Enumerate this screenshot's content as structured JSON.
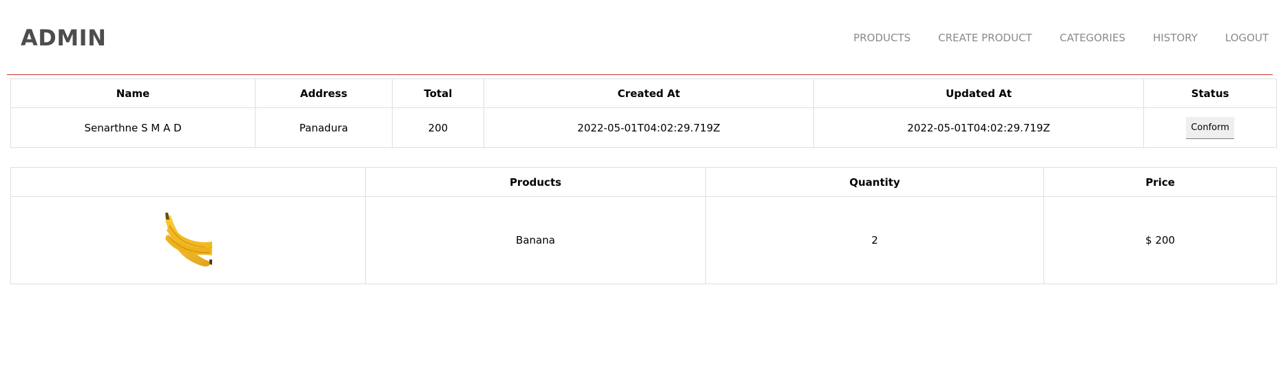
{
  "header": {
    "brand": "ADMIN",
    "nav": [
      "PRODUCTS",
      "CREATE PRODUCT",
      "CATEGORIES",
      "HISTORY",
      "LOGOUT"
    ]
  },
  "order": {
    "columns": [
      "Name",
      "Address",
      "Total",
      "Created At",
      "Updated At",
      "Status"
    ],
    "row": {
      "name": "Senarthne S M A D",
      "address": "Panadura",
      "total": "200",
      "created_at": "2022-05-01T04:02:29.719Z",
      "updated_at": "2022-05-01T04:02:29.719Z",
      "status_button": "Conform"
    }
  },
  "items": {
    "columns": [
      "",
      "Products",
      "Quantity",
      "Price"
    ],
    "rows": [
      {
        "image_icon": "banana-image",
        "product": "Banana",
        "quantity": "2",
        "price": "$ 200"
      }
    ]
  },
  "colors": {
    "divider": "#c9302c",
    "brand": "#4d4d4d",
    "nav": "#8a8a8a"
  }
}
